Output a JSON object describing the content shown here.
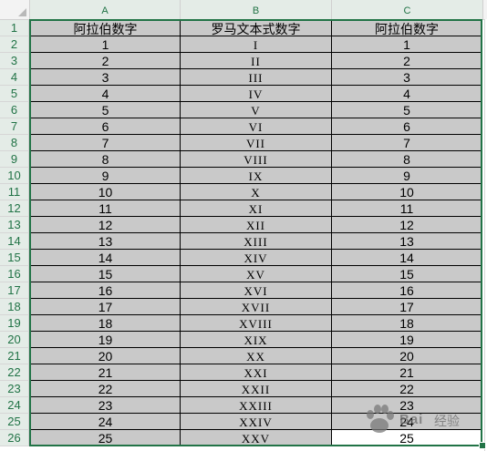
{
  "columns": [
    "A",
    "B",
    "C"
  ],
  "rows": [
    {
      "num": "1",
      "a": "阿拉伯数字",
      "b": "罗马文本式数字",
      "c": "阿拉伯数字"
    },
    {
      "num": "2",
      "a": "1",
      "b": "I",
      "c": "1"
    },
    {
      "num": "3",
      "a": "2",
      "b": "II",
      "c": "2"
    },
    {
      "num": "4",
      "a": "3",
      "b": "III",
      "c": "3"
    },
    {
      "num": "5",
      "a": "4",
      "b": "IV",
      "c": "4"
    },
    {
      "num": "6",
      "a": "5",
      "b": "V",
      "c": "5"
    },
    {
      "num": "7",
      "a": "6",
      "b": "VI",
      "c": "6"
    },
    {
      "num": "8",
      "a": "7",
      "b": "VII",
      "c": "7"
    },
    {
      "num": "9",
      "a": "8",
      "b": "VIII",
      "c": "8"
    },
    {
      "num": "10",
      "a": "9",
      "b": "IX",
      "c": "9"
    },
    {
      "num": "11",
      "a": "10",
      "b": "X",
      "c": "10"
    },
    {
      "num": "12",
      "a": "11",
      "b": "XI",
      "c": "11"
    },
    {
      "num": "13",
      "a": "12",
      "b": "XII",
      "c": "12"
    },
    {
      "num": "14",
      "a": "13",
      "b": "XIII",
      "c": "13"
    },
    {
      "num": "15",
      "a": "14",
      "b": "XIV",
      "c": "14"
    },
    {
      "num": "16",
      "a": "15",
      "b": "XV",
      "c": "15"
    },
    {
      "num": "17",
      "a": "16",
      "b": "XVI",
      "c": "16"
    },
    {
      "num": "18",
      "a": "17",
      "b": "XVII",
      "c": "17"
    },
    {
      "num": "19",
      "a": "18",
      "b": "XVIII",
      "c": "18"
    },
    {
      "num": "20",
      "a": "19",
      "b": "XIX",
      "c": "19"
    },
    {
      "num": "21",
      "a": "20",
      "b": "XX",
      "c": "20"
    },
    {
      "num": "22",
      "a": "21",
      "b": "XXI",
      "c": "21"
    },
    {
      "num": "23",
      "a": "22",
      "b": "XXII",
      "c": "22"
    },
    {
      "num": "24",
      "a": "23",
      "b": "XXIII",
      "c": "23"
    },
    {
      "num": "25",
      "a": "24",
      "b": "XXIV",
      "c": "24"
    },
    {
      "num": "26",
      "a": "25",
      "b": "XXV",
      "c": "25"
    }
  ],
  "watermark": {
    "brand": "Bai",
    "suffix": "经验"
  },
  "colors": {
    "header_text": "#217346",
    "selection": "#217346",
    "cell_fill": "#c9c9c9"
  }
}
